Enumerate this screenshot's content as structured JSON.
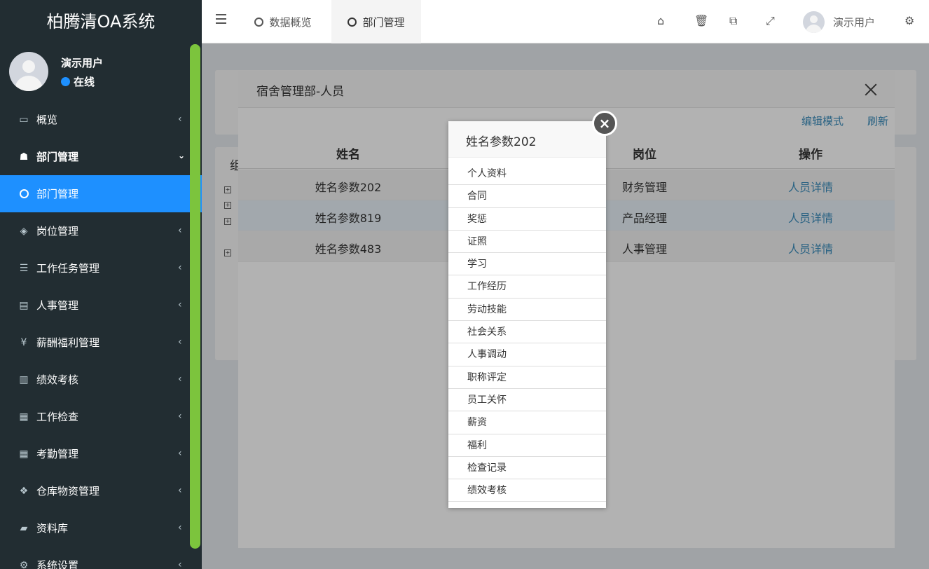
{
  "sidebar": {
    "logo": "柏腾清OA系统",
    "user_name": "演示用户",
    "user_status": "在线",
    "menu": [
      {
        "label": "概览",
        "icon": "monitor-icon"
      },
      {
        "label": "部门管理",
        "icon": "sitemap-icon"
      },
      {
        "label": "部门管理",
        "icon": "circle-icon"
      },
      {
        "label": "岗位管理",
        "icon": "cube-icon"
      },
      {
        "label": "工作任务管理",
        "icon": "list-icon"
      },
      {
        "label": "人事管理",
        "icon": "id-card-icon"
      },
      {
        "label": "薪酬福利管理",
        "icon": "yen-icon"
      },
      {
        "label": "绩效考核",
        "icon": "bar-chart-icon"
      },
      {
        "label": "工作检查",
        "icon": "calculator-icon"
      },
      {
        "label": "考勤管理",
        "icon": "calendar-icon"
      },
      {
        "label": "仓库物资管理",
        "icon": "cubes-icon"
      },
      {
        "label": "资料库",
        "icon": "book-icon"
      },
      {
        "label": "系统设置",
        "icon": "gear-icon"
      }
    ]
  },
  "topbar": {
    "tabs": [
      "数据概览",
      "部门管理"
    ],
    "user_name": "演示用户"
  },
  "modal": {
    "title": "宿舍管理部-人员",
    "edit_mode": "编辑模式",
    "refresh": "刷新",
    "columns": [
      "姓名",
      "岗位",
      "操作"
    ],
    "rows": [
      {
        "name": "姓名参数202",
        "position": "财务管理",
        "action": "人员详情"
      },
      {
        "name": "姓名参数819",
        "position": "产品经理",
        "action": "人员详情"
      },
      {
        "name": "姓名参数483",
        "position": "人事管理",
        "action": "人员详情"
      }
    ]
  },
  "background": {
    "card_label": "组"
  },
  "popup": {
    "title": "姓名参数202",
    "items": [
      "个人资料",
      "合同",
      "奖惩",
      "证照",
      "学习",
      "工作经历",
      "劳动技能",
      "社会关系",
      "人事调动",
      "职称评定",
      "员工关怀",
      "薪资",
      "福利",
      "检查记录",
      "绩效考核"
    ]
  }
}
